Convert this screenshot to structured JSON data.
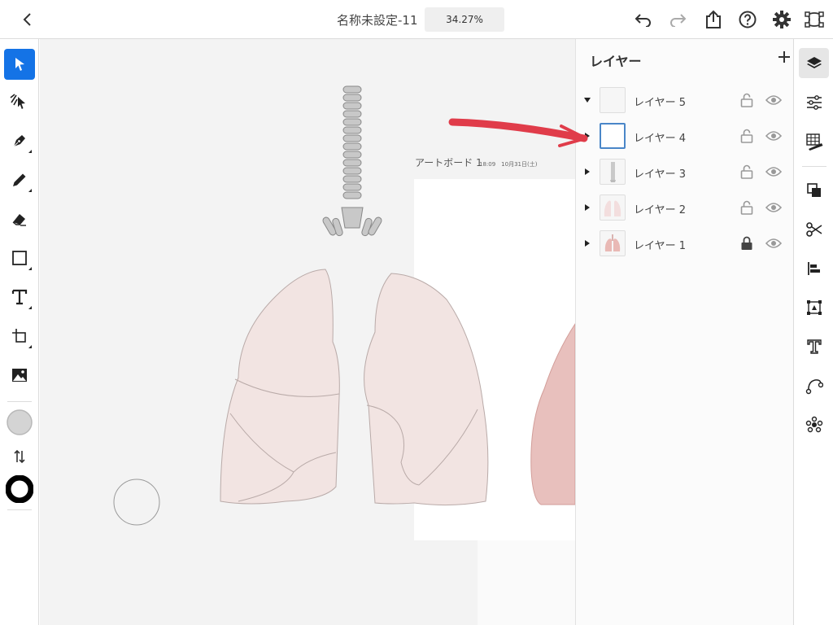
{
  "header": {
    "document_title": "名称未設定-11",
    "zoom": "34.27%"
  },
  "icons": {
    "back": "chevron-left-icon",
    "undo": "undo-icon",
    "redo": "redo-icon",
    "share": "share-icon",
    "help": "help-icon",
    "settings": "gear-icon",
    "profile": "path-edit-icon"
  },
  "tools": [
    {
      "name": "selection-tool",
      "icon": "arrow-icon",
      "active": true
    },
    {
      "name": "direct-selection-tool",
      "icon": "direct-select-icon"
    },
    {
      "name": "pen-tool",
      "icon": "pen-icon"
    },
    {
      "name": "pencil-tool",
      "icon": "pencil-icon"
    },
    {
      "name": "eraser-tool",
      "icon": "eraser-icon"
    },
    {
      "name": "rectangle-tool",
      "icon": "rectangle-icon"
    },
    {
      "name": "type-tool",
      "icon": "text-icon"
    },
    {
      "name": "artboard-tool",
      "icon": "artboard-icon"
    },
    {
      "name": "image-tool",
      "icon": "image-icon"
    }
  ],
  "colors": {
    "accent": "#1473e6",
    "fill_swatch": "#d4d4d4",
    "stroke_swatch": "#000000",
    "annotation_red": "#e03c4a",
    "lung_fill": "#f2e4e2"
  },
  "canvas": {
    "artboard_name": "アートボード 1",
    "artboard_meta": "18:09　10月31日(土)"
  },
  "layers_panel": {
    "title": "レイヤー",
    "add_icon": "plus-icon",
    "layers": [
      {
        "name": "レイヤー 5",
        "expanded": true,
        "locked": false,
        "visible": true,
        "selected": false
      },
      {
        "name": "レイヤー 4",
        "expanded": false,
        "locked": false,
        "visible": true,
        "selected": true
      },
      {
        "name": "レイヤー 3",
        "expanded": false,
        "locked": false,
        "visible": true,
        "selected": false
      },
      {
        "name": "レイヤー 2",
        "expanded": false,
        "locked": false,
        "visible": true,
        "selected": false
      },
      {
        "name": "レイヤー 1",
        "expanded": false,
        "locked": true,
        "visible": true,
        "selected": false
      }
    ]
  },
  "right_rail": [
    {
      "name": "layers-icon",
      "active": true
    },
    {
      "name": "properties-icon"
    },
    {
      "name": "grid-ruler-icon"
    },
    {
      "name": "arrange-icon"
    },
    {
      "name": "cut-icon"
    },
    {
      "name": "align-icon"
    },
    {
      "name": "transform-icon"
    },
    {
      "name": "font-icon"
    },
    {
      "name": "path-icon"
    },
    {
      "name": "repeat-icon"
    }
  ]
}
